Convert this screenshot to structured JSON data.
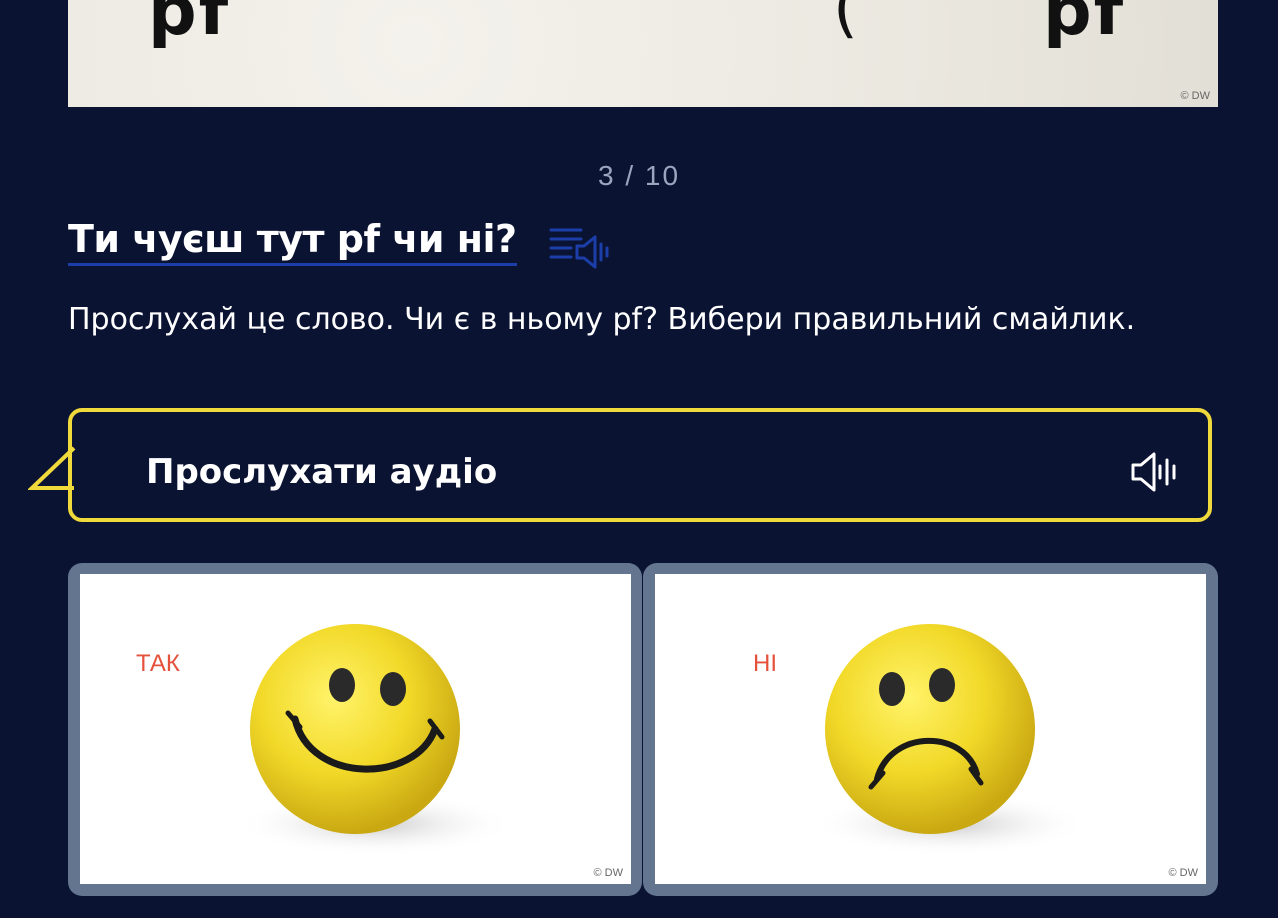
{
  "hero": {
    "glyphs": [
      "pf",
      "(",
      "pf"
    ],
    "credit": "© DW"
  },
  "progress": {
    "counter": "3 / 10"
  },
  "question": {
    "title": "Ти чуєш тут pf чи ні?",
    "transcript_icon": "transcript-audio-icon",
    "instruction": "Прослухай це слово. Чи є в ньому pf? Вибери правильний смайлик."
  },
  "audio": {
    "label": "Прослухати аудіо",
    "icon": "speaker-icon",
    "border_color": "#f0d93a"
  },
  "answers": [
    {
      "label": "ТАК",
      "image": "happy-smiley",
      "credit": "© DW"
    },
    {
      "label": "НІ",
      "image": "sad-smiley",
      "credit": "© DW"
    }
  ],
  "colors": {
    "background": "#0b1333",
    "accent_underline": "#1c3ea8",
    "answer_text": "#e5523b",
    "card_frame": "#647590"
  }
}
